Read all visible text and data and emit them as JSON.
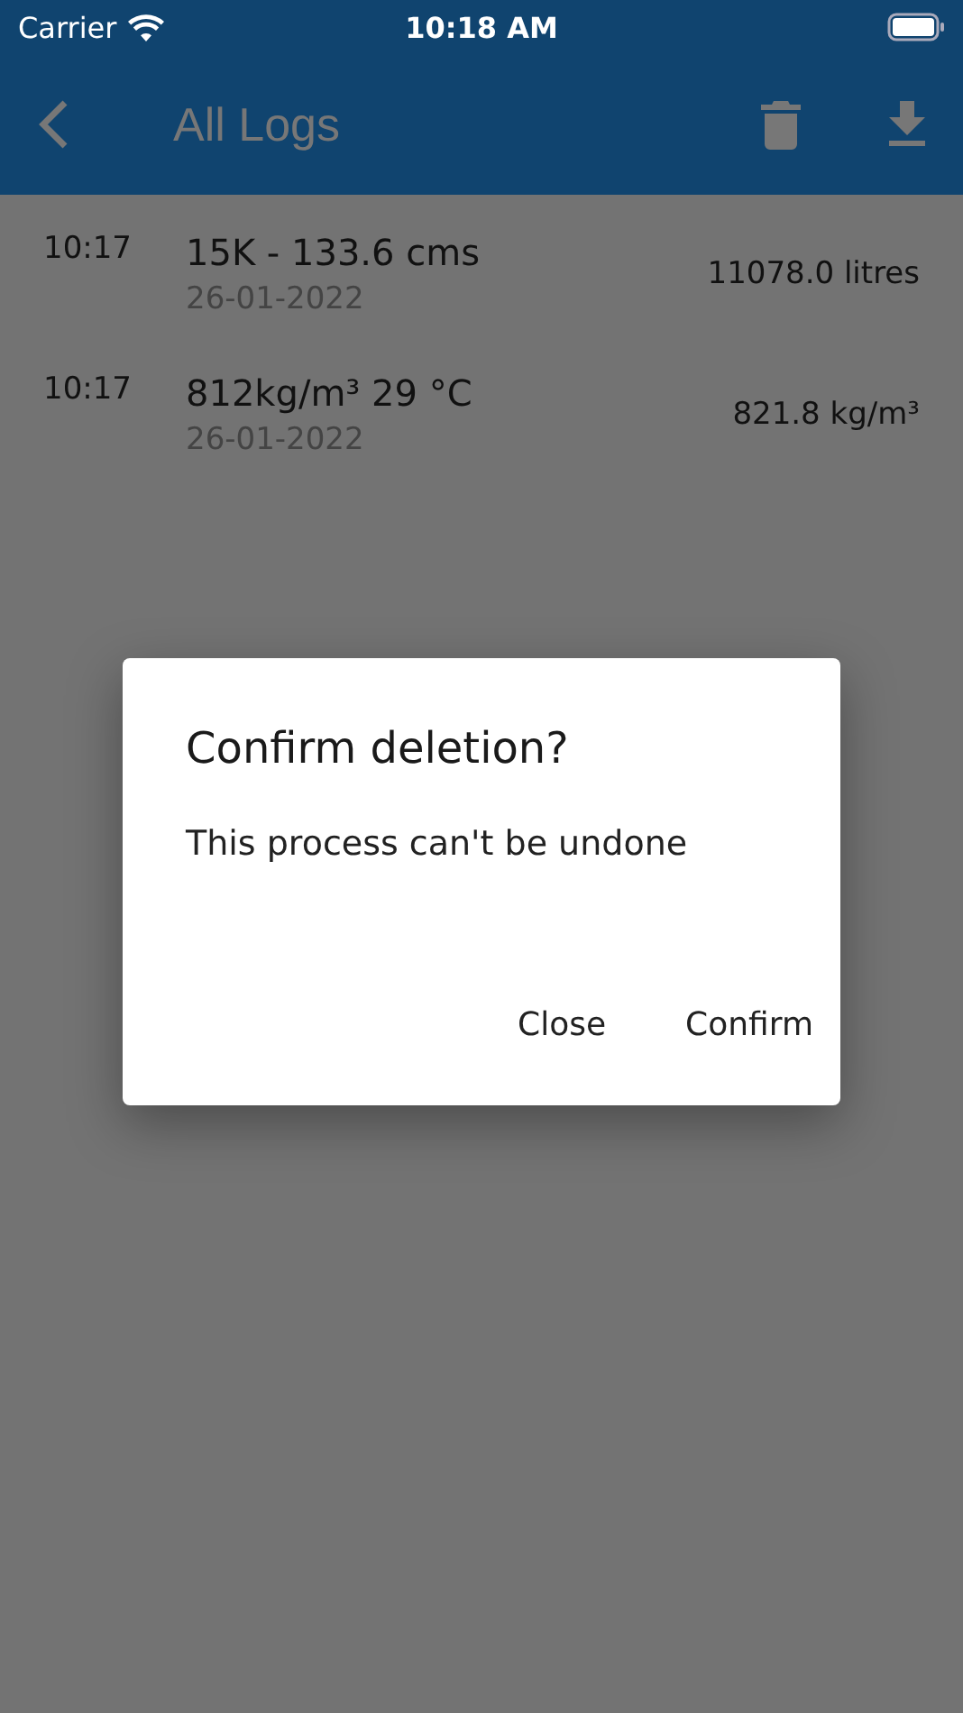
{
  "status_bar": {
    "carrier": "Carrier",
    "time": "10:18 AM"
  },
  "app_bar": {
    "title": "All Logs"
  },
  "logs": [
    {
      "time": "10:17",
      "title": "15K - 133.6 cms",
      "date": "26-01-2022",
      "value": "11078.0 litres"
    },
    {
      "time": "10:17",
      "title": "812kg/m³ 29 °C",
      "date": "26-01-2022",
      "value": "821.8 kg/m³"
    }
  ],
  "dialog": {
    "title": "Confirm deletion?",
    "message": "This process can't be undone",
    "buttons": [
      "Close",
      "Confirm"
    ]
  }
}
